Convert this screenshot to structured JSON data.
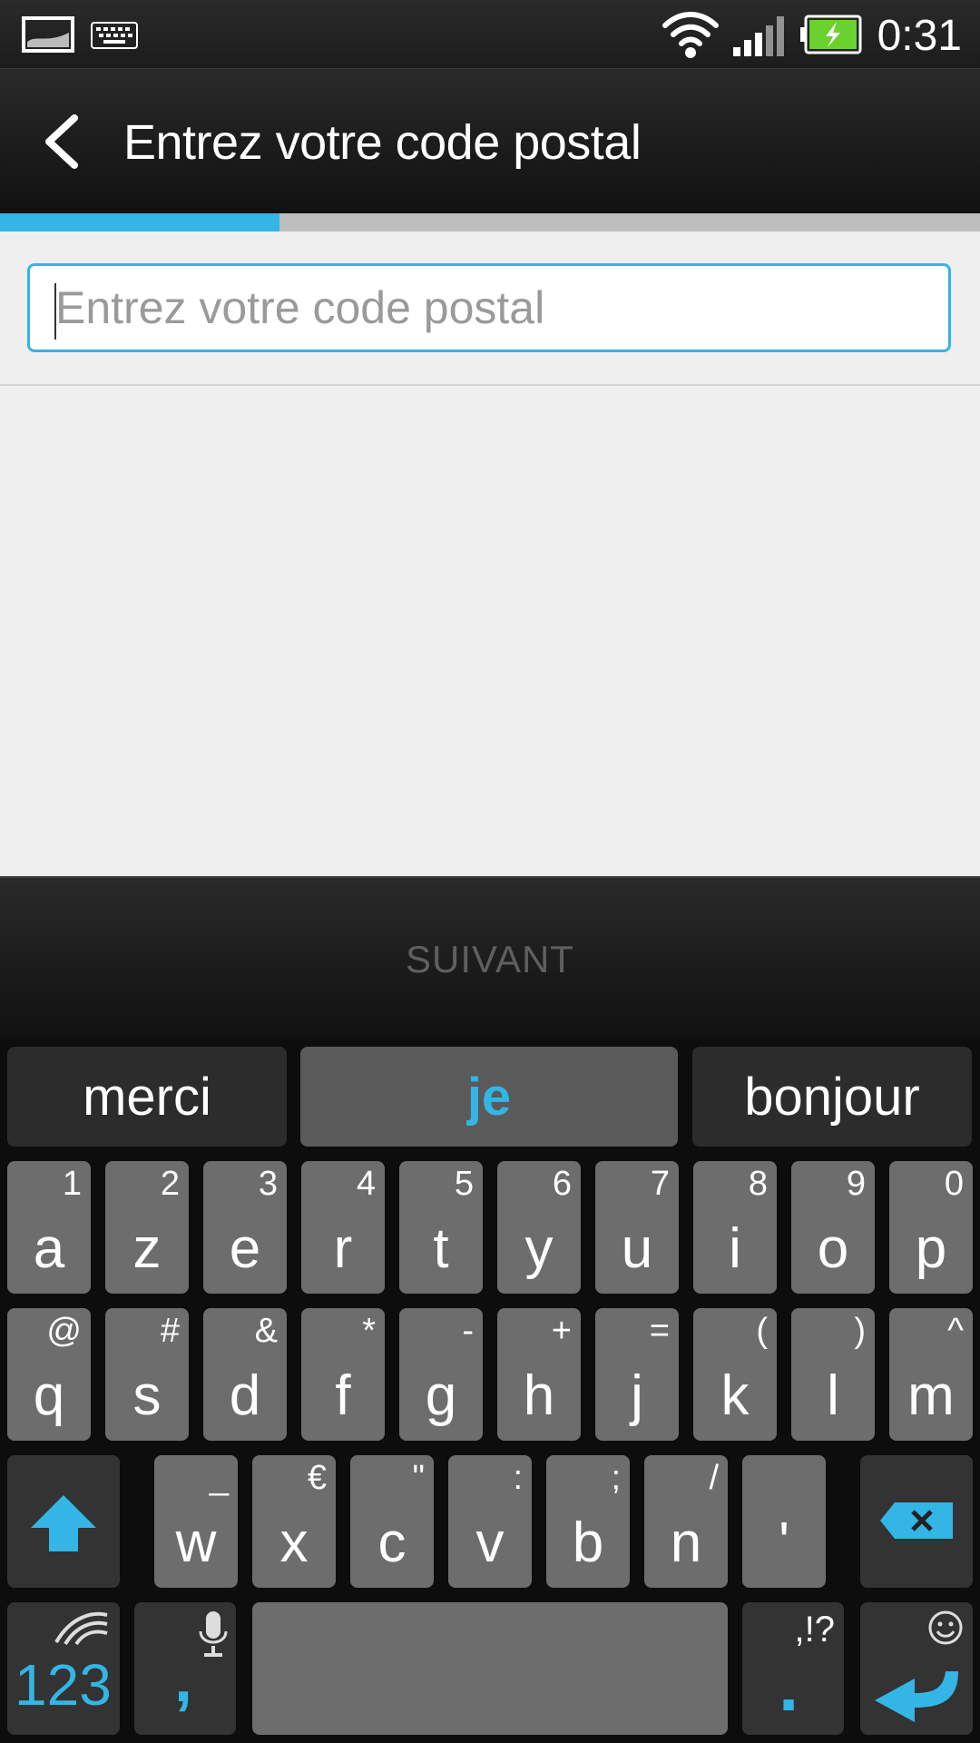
{
  "status_bar": {
    "time": "0:31",
    "icons": [
      "gallery-notification-icon",
      "keyboard-notification-icon",
      "wifi-icon",
      "signal-icon",
      "battery-charging-icon"
    ],
    "battery_color": "#6bd12e"
  },
  "header": {
    "title": "Entrez votre code postal"
  },
  "progress": {
    "fraction": 0.285,
    "color": "#33b5e5"
  },
  "postal_input": {
    "value": "",
    "placeholder": "Entrez votre code postal"
  },
  "bottom_button": {
    "label": "SUIVANT"
  },
  "keyboard": {
    "suggestions": [
      "merci",
      "je",
      "bonjour"
    ],
    "row1": [
      {
        "main": "a",
        "sec": "1"
      },
      {
        "main": "z",
        "sec": "2"
      },
      {
        "main": "e",
        "sec": "3"
      },
      {
        "main": "r",
        "sec": "4"
      },
      {
        "main": "t",
        "sec": "5"
      },
      {
        "main": "y",
        "sec": "6"
      },
      {
        "main": "u",
        "sec": "7"
      },
      {
        "main": "i",
        "sec": "8"
      },
      {
        "main": "o",
        "sec": "9"
      },
      {
        "main": "p",
        "sec": "0"
      }
    ],
    "row2": [
      {
        "main": "q",
        "sec": "@"
      },
      {
        "main": "s",
        "sec": "#"
      },
      {
        "main": "d",
        "sec": "&"
      },
      {
        "main": "f",
        "sec": "*"
      },
      {
        "main": "g",
        "sec": "-"
      },
      {
        "main": "h",
        "sec": "+"
      },
      {
        "main": "j",
        "sec": "="
      },
      {
        "main": "k",
        "sec": "("
      },
      {
        "main": "l",
        "sec": ")"
      },
      {
        "main": "m",
        "sec": "^"
      }
    ],
    "row3": [
      {
        "main": "w",
        "sec": "_"
      },
      {
        "main": "x",
        "sec": "€"
      },
      {
        "main": "c",
        "sec": "\""
      },
      {
        "main": "v",
        "sec": ":"
      },
      {
        "main": "b",
        "sec": ";"
      },
      {
        "main": "n",
        "sec": "/"
      },
      {
        "main": "'",
        "sec": ""
      }
    ],
    "numbers_label": "123",
    "comma_label": ",",
    "period_label": ".",
    "punct_label": ",!?",
    "accent_color": "#33b5e5"
  }
}
